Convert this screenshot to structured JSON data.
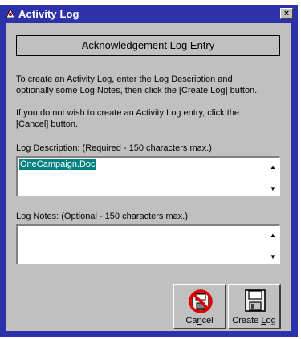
{
  "window": {
    "title": "Activity Log",
    "close_glyph": "×"
  },
  "header": {
    "text": "Acknowledgement Log Entry"
  },
  "instructions": {
    "line1": "To create an Activity Log, enter the Log Description and",
    "line2": "optionally some Log Notes, then click the [Create Log] button.",
    "line3": "If you do not wish to create an Activity Log entry, click the",
    "line4": "[Cancel] button."
  },
  "log_description": {
    "label": "Log Description:  (Required - 150 characters max.)",
    "value": "OneCampaign.Doc"
  },
  "log_notes": {
    "label": "Log Notes:  (Optional - 150 characters max.)",
    "value": ""
  },
  "buttons": {
    "cancel": {
      "pre": "Ca",
      "underline": "n",
      "post": "cel",
      "icon": "no-floppy-icon"
    },
    "create": {
      "pre": "Create ",
      "underline": "L",
      "post": "og",
      "icon": "floppy-disk-icon"
    }
  },
  "scroll_arrows": {
    "up": "▲",
    "down": "▼"
  },
  "colors": {
    "title_bar": "#2e32a8",
    "face": "#c0c0c0",
    "selection": "#008080",
    "prohibit": "#e00000"
  }
}
